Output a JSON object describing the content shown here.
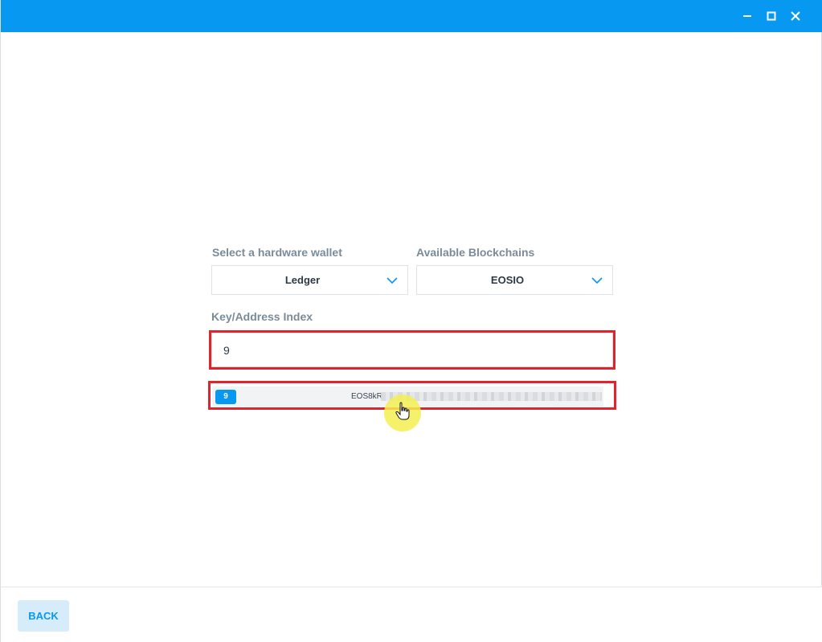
{
  "window": {
    "title_bar_color": "#0799f2",
    "controls": [
      "minimize-icon",
      "maximize-icon",
      "close-icon"
    ]
  },
  "form": {
    "wallet_label": "Select a hardware wallet",
    "wallet_value": "Ledger",
    "chain_label": "Available Blockchains",
    "chain_value": "EOSIO",
    "index_label": "Key/Address Index",
    "index_value": "9"
  },
  "key_result": {
    "index_badge": "9",
    "key_prefix": "EOS8kR",
    "key_obscured": true
  },
  "footer": {
    "back_label": "BACK"
  },
  "colors": {
    "accent": "#0799f2",
    "highlight_border": "#e0242d",
    "label": "#7a8b99"
  }
}
